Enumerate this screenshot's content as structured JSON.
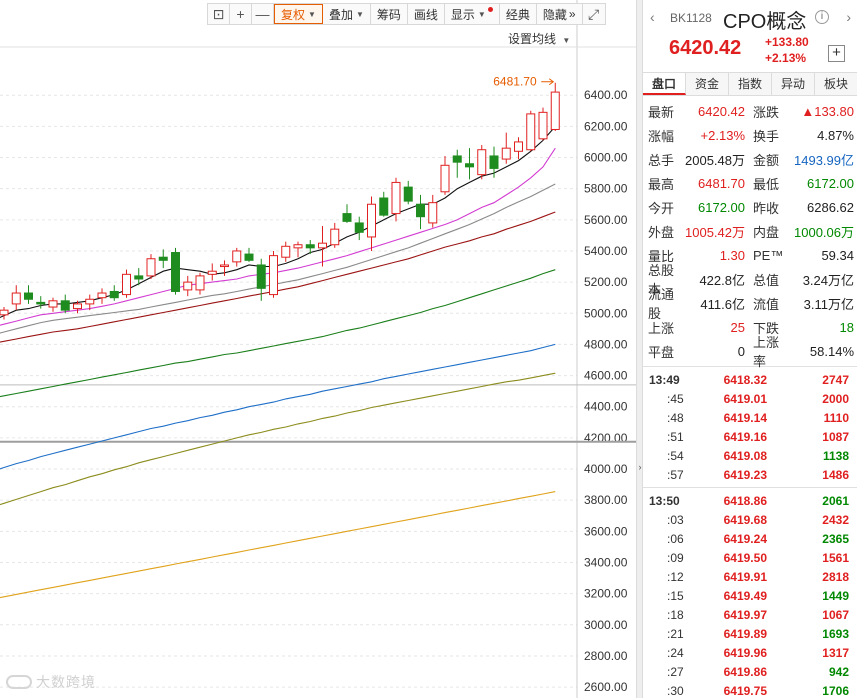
{
  "toolbar": {
    "items": [
      {
        "label": "",
        "icon": "lock-icon"
      },
      {
        "label": "+",
        "icon": "zoom-in-icon"
      },
      {
        "label": "—",
        "icon": "zoom-out-icon"
      },
      {
        "label": "复权",
        "dropdown": true,
        "active": true
      },
      {
        "label": "叠加",
        "dropdown": true
      },
      {
        "label": "筹码"
      },
      {
        "label": "画线"
      },
      {
        "label": "显示",
        "dropdown": true,
        "dot": true
      },
      {
        "label": "经典"
      },
      {
        "label": "隐藏"
      },
      {
        "label": "",
        "icon": "fullscreen-icon"
      }
    ],
    "hide_arrow": "»"
  },
  "ma_setting": "设置均线",
  "max_price_label": "6481.70",
  "watermark": "大数跨境",
  "chart_data": {
    "type": "candlestick",
    "y_ticks": [
      6400,
      6200,
      6000,
      5800,
      5600,
      5400,
      5200,
      5000,
      4800,
      4600,
      4400,
      4200,
      4000,
      3800,
      3600,
      3400,
      3200,
      3000,
      2800,
      2600
    ],
    "y_tick_labels": [
      "6400.00",
      "6200.00",
      "6000.00",
      "5800.00",
      "5600.00",
      "5400.00",
      "5200.00",
      "5000.00",
      "4800.00",
      "4600.00",
      "4400.00",
      "4200.00",
      "4000.00",
      "3800.00",
      "3600.00",
      "3400.00",
      "3200.00",
      "3000.00",
      "2800.00",
      "2600.00"
    ],
    "ylim": [
      2530,
      6870
    ],
    "reference_lines": [
      4540,
      4175
    ],
    "candles": [
      {
        "o": 4990,
        "h": 5040,
        "l": 4960,
        "c": 5020
      },
      {
        "o": 5060,
        "h": 5180,
        "l": 5020,
        "c": 5130
      },
      {
        "o": 5130,
        "h": 5180,
        "l": 5060,
        "c": 5090
      },
      {
        "o": 5070,
        "h": 5110,
        "l": 5030,
        "c": 5060
      },
      {
        "o": 5040,
        "h": 5100,
        "l": 5010,
        "c": 5080
      },
      {
        "o": 5080,
        "h": 5120,
        "l": 5000,
        "c": 5020
      },
      {
        "o": 5030,
        "h": 5080,
        "l": 5000,
        "c": 5060
      },
      {
        "o": 5060,
        "h": 5120,
        "l": 5020,
        "c": 5090
      },
      {
        "o": 5100,
        "h": 5160,
        "l": 5060,
        "c": 5130
      },
      {
        "o": 5140,
        "h": 5180,
        "l": 5080,
        "c": 5100
      },
      {
        "o": 5120,
        "h": 5280,
        "l": 5100,
        "c": 5250
      },
      {
        "o": 5240,
        "h": 5290,
        "l": 5180,
        "c": 5220
      },
      {
        "o": 5240,
        "h": 5380,
        "l": 5220,
        "c": 5350
      },
      {
        "o": 5360,
        "h": 5410,
        "l": 5290,
        "c": 5340
      },
      {
        "o": 5390,
        "h": 5420,
        "l": 5120,
        "c": 5140
      },
      {
        "o": 5150,
        "h": 5240,
        "l": 5110,
        "c": 5200
      },
      {
        "o": 5150,
        "h": 5260,
        "l": 5120,
        "c": 5240
      },
      {
        "o": 5250,
        "h": 5320,
        "l": 5210,
        "c": 5270
      },
      {
        "o": 5300,
        "h": 5340,
        "l": 5240,
        "c": 5310
      },
      {
        "o": 5330,
        "h": 5420,
        "l": 5300,
        "c": 5400
      },
      {
        "o": 5380,
        "h": 5420,
        "l": 5330,
        "c": 5340
      },
      {
        "o": 5310,
        "h": 5350,
        "l": 5080,
        "c": 5160
      },
      {
        "o": 5120,
        "h": 5400,
        "l": 5100,
        "c": 5370
      },
      {
        "o": 5360,
        "h": 5460,
        "l": 5330,
        "c": 5430
      },
      {
        "o": 5420,
        "h": 5460,
        "l": 5360,
        "c": 5440
      },
      {
        "o": 5440,
        "h": 5470,
        "l": 5380,
        "c": 5420
      },
      {
        "o": 5420,
        "h": 5560,
        "l": 5300,
        "c": 5450
      },
      {
        "o": 5440,
        "h": 5580,
        "l": 5420,
        "c": 5540
      },
      {
        "o": 5640,
        "h": 5700,
        "l": 5580,
        "c": 5590
      },
      {
        "o": 5580,
        "h": 5620,
        "l": 5470,
        "c": 5520
      },
      {
        "o": 5490,
        "h": 5750,
        "l": 5400,
        "c": 5700
      },
      {
        "o": 5740,
        "h": 5780,
        "l": 5620,
        "c": 5630
      },
      {
        "o": 5640,
        "h": 5870,
        "l": 5590,
        "c": 5840
      },
      {
        "o": 5810,
        "h": 5850,
        "l": 5700,
        "c": 5720
      },
      {
        "o": 5700,
        "h": 5760,
        "l": 5540,
        "c": 5620
      },
      {
        "o": 5580,
        "h": 5760,
        "l": 5550,
        "c": 5710
      },
      {
        "o": 5780,
        "h": 6010,
        "l": 5760,
        "c": 5950
      },
      {
        "o": 6010,
        "h": 6050,
        "l": 5870,
        "c": 5970
      },
      {
        "o": 5960,
        "h": 6060,
        "l": 5860,
        "c": 5940
      },
      {
        "o": 5890,
        "h": 6080,
        "l": 5860,
        "c": 6050
      },
      {
        "o": 6010,
        "h": 6070,
        "l": 5870,
        "c": 5930
      },
      {
        "o": 5990,
        "h": 6160,
        "l": 5960,
        "c": 6060
      },
      {
        "o": 6040,
        "h": 6130,
        "l": 5990,
        "c": 6100
      },
      {
        "o": 6050,
        "h": 6300,
        "l": 6040,
        "c": 6280
      },
      {
        "o": 6120,
        "h": 6320,
        "l": 6110,
        "c": 6290
      },
      {
        "o": 6180,
        "h": 6480,
        "l": 6170,
        "c": 6420
      }
    ],
    "ma": [
      {
        "color": "#111111",
        "values": [
          4985,
          5020,
          5030,
          5050,
          5060,
          5060,
          5070,
          5080,
          5100,
          5120,
          5150,
          5190,
          5230,
          5270,
          5290,
          5280,
          5270,
          5250,
          5260,
          5280,
          5310,
          5300,
          5300,
          5320,
          5350,
          5390,
          5410,
          5450,
          5490,
          5520,
          5560,
          5600,
          5640,
          5670,
          5700,
          5700,
          5740,
          5800,
          5840,
          5880,
          5900,
          5940,
          5980,
          6040,
          6110,
          6200
        ]
      },
      {
        "color": "#d23cd2",
        "values": [
          4930,
          4950,
          4970,
          4990,
          5000,
          5010,
          5020,
          5030,
          5045,
          5060,
          5080,
          5100,
          5120,
          5140,
          5160,
          5180,
          5190,
          5200,
          5210,
          5220,
          5240,
          5250,
          5260,
          5275,
          5290,
          5310,
          5330,
          5350,
          5370,
          5395,
          5420,
          5445,
          5470,
          5495,
          5520,
          5545,
          5570,
          5600,
          5640,
          5680,
          5710,
          5760,
          5810,
          5870,
          5940,
          6060
        ]
      },
      {
        "color": "#8a8a8a",
        "values": [
          4880,
          4900,
          4920,
          4940,
          4955,
          4965,
          4975,
          4985,
          4995,
          5005,
          5015,
          5025,
          5040,
          5055,
          5070,
          5085,
          5100,
          5115,
          5125,
          5140,
          5155,
          5170,
          5185,
          5200,
          5215,
          5235,
          5255,
          5275,
          5295,
          5320,
          5345,
          5370,
          5395,
          5420,
          5450,
          5480,
          5510,
          5540,
          5570,
          5605,
          5640,
          5680,
          5715,
          5750,
          5790,
          5830
        ]
      },
      {
        "color": "#9b1414",
        "values": [
          4820,
          4835,
          4850,
          4865,
          4880,
          4890,
          4900,
          4915,
          4930,
          4945,
          4960,
          4975,
          4990,
          5005,
          5020,
          5035,
          5050,
          5065,
          5080,
          5095,
          5110,
          5125,
          5140,
          5155,
          5170,
          5190,
          5210,
          5230,
          5250,
          5270,
          5290,
          5310,
          5330,
          5350,
          5375,
          5400,
          5425,
          5445,
          5465,
          5490,
          5510,
          5540,
          5565,
          5590,
          5620,
          5650
        ]
      },
      {
        "color": "#1a7f1a",
        "values": [
          4470,
          4485,
          4500,
          4515,
          4530,
          4545,
          4560,
          4575,
          4590,
          4605,
          4620,
          4635,
          4650,
          4665,
          4680,
          4690,
          4705,
          4720,
          4735,
          4745,
          4760,
          4775,
          4790,
          4805,
          4820,
          4835,
          4850,
          4870,
          4890,
          4905,
          4925,
          4945,
          4965,
          4985,
          5005,
          5030,
          5050,
          5075,
          5100,
          5125,
          5150,
          5175,
          5200,
          5225,
          5255,
          5280
        ]
      },
      {
        "color": "#1e6fc8",
        "values": [
          4010,
          4035,
          4055,
          4080,
          4100,
          4120,
          4140,
          4160,
          4180,
          4200,
          4220,
          4240,
          4260,
          4275,
          4295,
          4310,
          4330,
          4345,
          4365,
          4380,
          4400,
          4415,
          4430,
          4450,
          4465,
          4480,
          4500,
          4515,
          4530,
          4545,
          4560,
          4580,
          4595,
          4610,
          4625,
          4640,
          4655,
          4670,
          4685,
          4700,
          4715,
          4730,
          4745,
          4760,
          4780,
          4800
        ]
      },
      {
        "color": "#8c8c1e",
        "values": [
          3780,
          3805,
          3830,
          3855,
          3880,
          3900,
          3925,
          3950,
          3970,
          3995,
          4015,
          4040,
          4060,
          4080,
          4100,
          4120,
          4140,
          4160,
          4180,
          4200,
          4220,
          4235,
          4255,
          4270,
          4290,
          4305,
          4325,
          4340,
          4360,
          4375,
          4395,
          4410,
          4425,
          4440,
          4455,
          4470,
          4485,
          4500,
          4515,
          4530,
          4545,
          4560,
          4570,
          4585,
          4600,
          4615
        ]
      },
      {
        "color": "#e0a21a",
        "values": [
          3180,
          3195,
          3210,
          3225,
          3240,
          3255,
          3270,
          3285,
          3300,
          3315,
          3330,
          3345,
          3360,
          3375,
          3390,
          3405,
          3420,
          3435,
          3450,
          3465,
          3480,
          3495,
          3510,
          3525,
          3540,
          3555,
          3570,
          3585,
          3600,
          3615,
          3630,
          3645,
          3660,
          3675,
          3690,
          3705,
          3720,
          3735,
          3750,
          3765,
          3780,
          3795,
          3810,
          3825,
          3840,
          3855
        ]
      }
    ]
  },
  "quote": {
    "nav_left": "‹",
    "nav_right": "›",
    "code": "BK1128",
    "name": "CPO概念",
    "info": "i",
    "price": "6420.42",
    "change": "+133.80",
    "change_pct": "+2.13%",
    "add": "+",
    "tabs": [
      "盘口",
      "资金",
      "指数",
      "异动",
      "板块"
    ],
    "stats": [
      {
        "l": "最新",
        "v": "6420.42",
        "vc": "red",
        "r": "涨跌",
        "v2": "▲133.80",
        "v2c": "red"
      },
      {
        "l": "涨幅",
        "v": "+2.13%",
        "vc": "red",
        "r": "换手",
        "v2": "4.87%",
        "v2c": ""
      },
      {
        "l": "总手",
        "v": "2005.48万",
        "vc": "",
        "r": "金额",
        "v2": "1493.99亿",
        "v2c": "blue"
      },
      {
        "l": "最高",
        "v": "6481.70",
        "vc": "red",
        "r": "最低",
        "v2": "6172.00",
        "v2c": "green"
      },
      {
        "l": "今开",
        "v": "6172.00",
        "vc": "green",
        "r": "昨收",
        "v2": "6286.62",
        "v2c": ""
      },
      {
        "l": "外盘",
        "v": "1005.42万",
        "vc": "red",
        "r": "内盘",
        "v2": "1000.06万",
        "v2c": "green"
      },
      {
        "l": "量比",
        "v": "1.30",
        "vc": "red",
        "r": "PE™",
        "v2": "59.34",
        "v2c": ""
      },
      {
        "l": "总股本",
        "v": "422.8亿",
        "vc": "",
        "r": "总值",
        "v2": "3.24万亿",
        "v2c": ""
      },
      {
        "l": "流通股",
        "v": "411.6亿",
        "vc": "",
        "r": "流值",
        "v2": "3.11万亿",
        "v2c": ""
      },
      {
        "l": "上涨",
        "v": "25",
        "vc": "red",
        "r": "下跌",
        "v2": "18",
        "v2c": "green"
      },
      {
        "l": "平盘",
        "v": "0",
        "vc": "",
        "r": "上涨率",
        "v2": "58.14%",
        "v2c": ""
      }
    ],
    "ticks_group1": [
      {
        "t": "13:49",
        "p": "6418.32",
        "v": "2747",
        "vc": "red"
      },
      {
        "t": ":45",
        "p": "6419.01",
        "v": "2000",
        "vc": "red"
      },
      {
        "t": ":48",
        "p": "6419.14",
        "v": "1110",
        "vc": "red"
      },
      {
        "t": ":51",
        "p": "6419.16",
        "v": "1087",
        "vc": "red"
      },
      {
        "t": ":54",
        "p": "6419.08",
        "v": "1138",
        "vc": "green"
      },
      {
        "t": ":57",
        "p": "6419.23",
        "v": "1486",
        "vc": "red"
      }
    ],
    "ticks_group2": [
      {
        "t": "13:50",
        "p": "6418.86",
        "v": "2061",
        "vc": "green"
      },
      {
        "t": ":03",
        "p": "6419.68",
        "v": "2432",
        "vc": "red"
      },
      {
        "t": ":06",
        "p": "6419.24",
        "v": "2365",
        "vc": "green"
      },
      {
        "t": ":09",
        "p": "6419.50",
        "v": "1561",
        "vc": "red"
      },
      {
        "t": ":12",
        "p": "6419.91",
        "v": "2818",
        "vc": "red"
      },
      {
        "t": ":15",
        "p": "6419.49",
        "v": "1449",
        "vc": "green"
      },
      {
        "t": ":18",
        "p": "6419.97",
        "v": "1067",
        "vc": "red"
      },
      {
        "t": ":21",
        "p": "6419.89",
        "v": "1693",
        "vc": "green"
      },
      {
        "t": ":24",
        "p": "6419.96",
        "v": "1317",
        "vc": "red"
      },
      {
        "t": ":27",
        "p": "6419.86",
        "v": "942",
        "vc": "green"
      },
      {
        "t": ":30",
        "p": "6419.75",
        "v": "1706",
        "vc": "green"
      }
    ]
  }
}
